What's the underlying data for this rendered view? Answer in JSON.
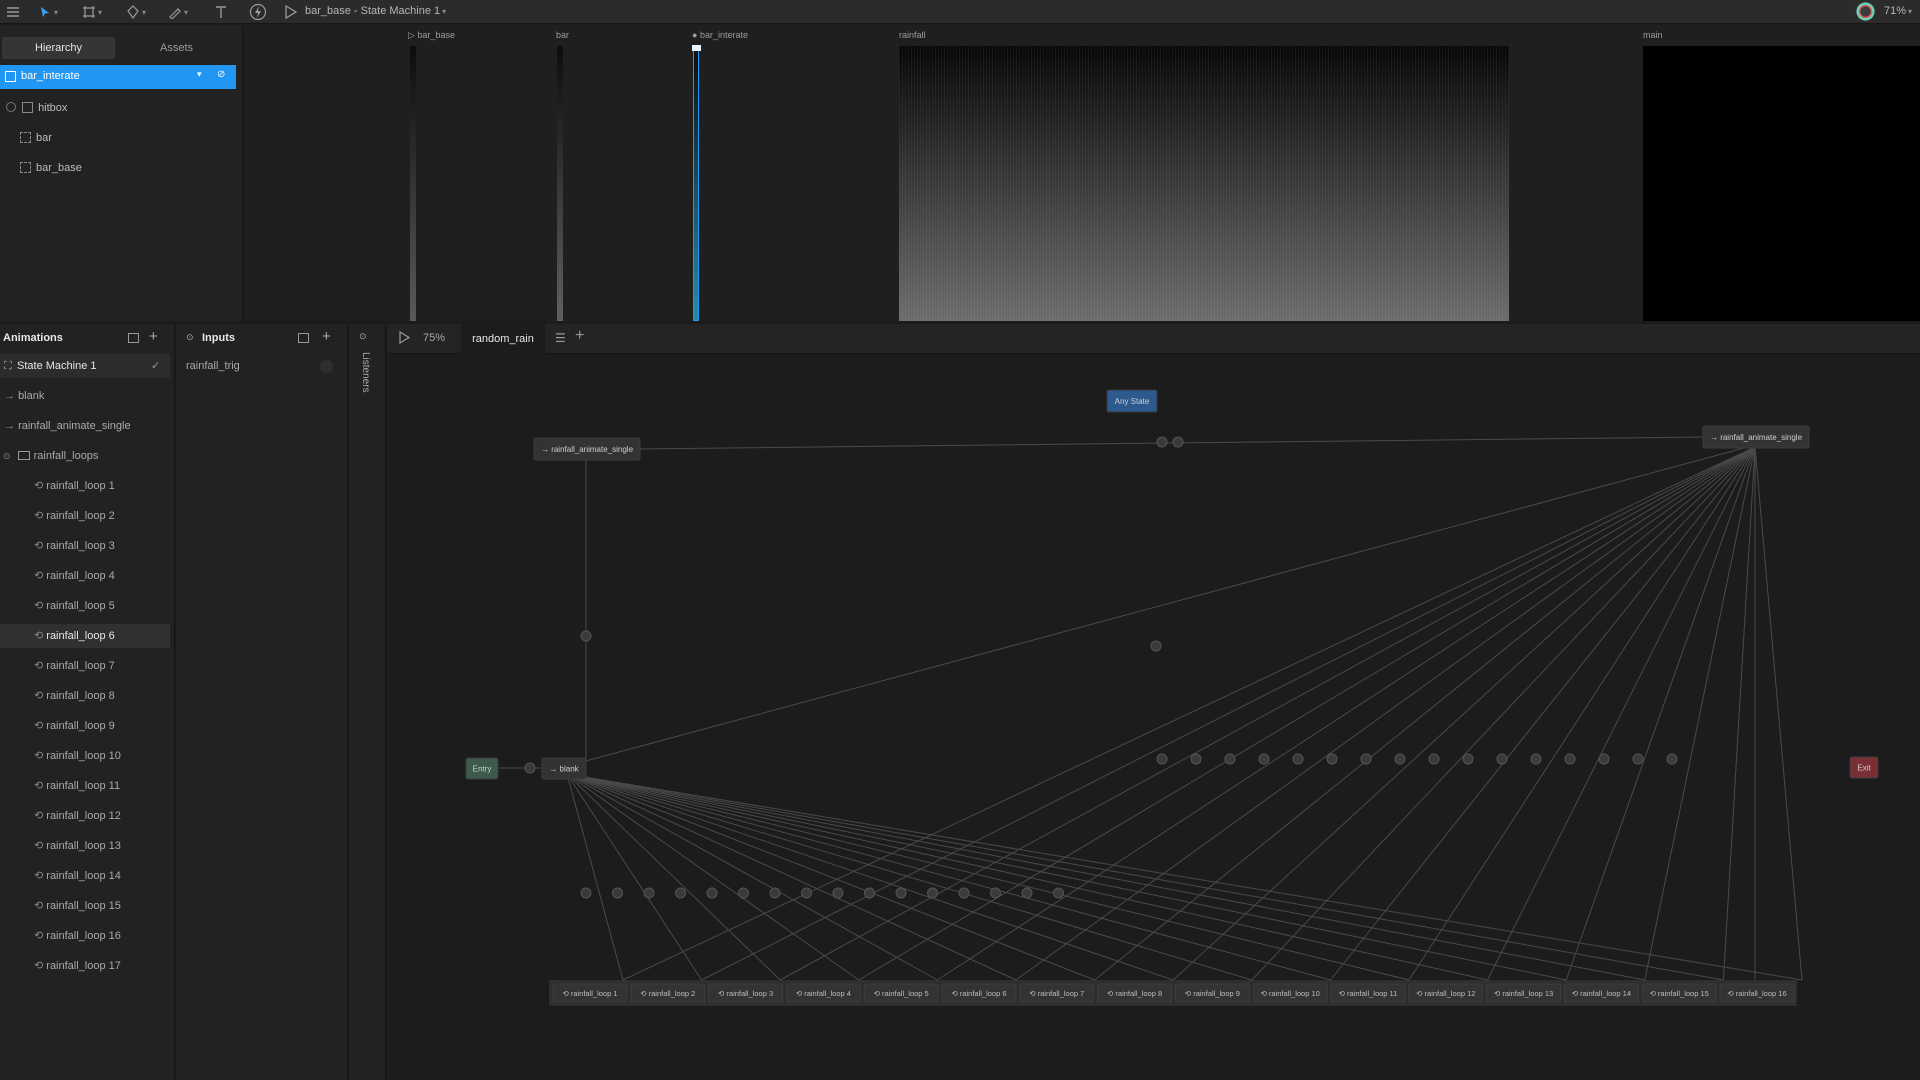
{
  "toolbar": {
    "doc_title": "bar_base - State Machine 1",
    "zoom": "71%"
  },
  "hierarchy": {
    "tabs": [
      "Hierarchy",
      "Assets"
    ],
    "selected_artboard": "bar_interate",
    "items": [
      "hitbox",
      "bar",
      "bar_base"
    ]
  },
  "artboards": {
    "labels": [
      "bar_base",
      "bar",
      "bar_interate",
      "rainfall",
      "main"
    ]
  },
  "animations": {
    "title": "Animations",
    "state_machine": "State Machine 1",
    "items": [
      "blank",
      "rainfall_animate_single"
    ],
    "folder": "rainfall_loops",
    "loops": [
      "rainfall_loop 1",
      "rainfall_loop 2",
      "rainfall_loop 3",
      "rainfall_loop 4",
      "rainfall_loop 5",
      "rainfall_loop 6",
      "rainfall_loop 7",
      "rainfall_loop 8",
      "rainfall_loop 9",
      "rainfall_loop 10",
      "rainfall_loop 11",
      "rainfall_loop 12",
      "rainfall_loop 13",
      "rainfall_loop 14",
      "rainfall_loop 15",
      "rainfall_loop 16",
      "rainfall_loop 17"
    ],
    "selected_loop": "rainfall_loop 6"
  },
  "inputs": {
    "title": "Inputs",
    "items": [
      "rainfall_trig"
    ]
  },
  "listeners": {
    "title": "Listeners"
  },
  "graph": {
    "zoom": "75%",
    "tab": "random_rain",
    "any_state": "Any State",
    "entry": "Entry",
    "exit": "Exit",
    "blank": "blank",
    "animate_left": "rainfall_animate_single",
    "animate_right": "rainfall_animate_single",
    "loops": [
      "rainfall_loop 1",
      "rainfall_loop 2",
      "rainfall_loop 3",
      "rainfall_loop 4",
      "rainfall_loop 5",
      "rainfall_loop 6",
      "rainfall_loop 7",
      "rainfall_loop 8",
      "rainfall_loop 9",
      "rainfall_loop 10",
      "rainfall_loop 11",
      "rainfall_loop 12",
      "rainfall_loop 13",
      "rainfall_loop 14",
      "rainfall_loop 15",
      "rainfall_loop 16"
    ]
  },
  "colors": {
    "accent": "#2196f3",
    "any_state": "#2d5a8e",
    "entry": "#3d5a4b",
    "exit": "#7a2f34"
  }
}
